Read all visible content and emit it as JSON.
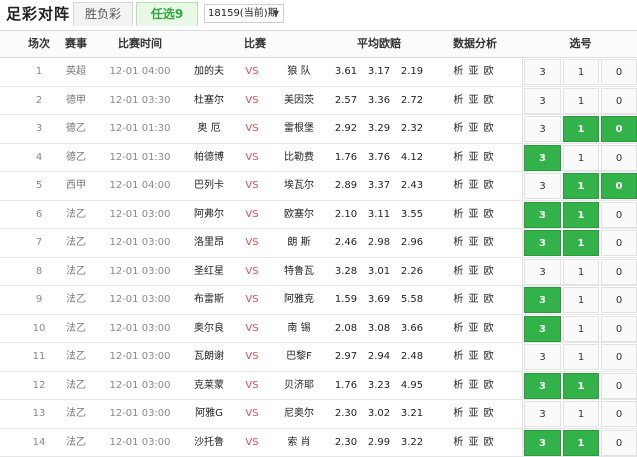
{
  "header": {
    "app_title": "足彩对阵",
    "tabs": [
      "胜负彩",
      "任选9"
    ],
    "period": "18159(当前)期",
    "period_caret": "▼"
  },
  "columns": {
    "no": "场次",
    "league": "赛事",
    "time": "比赛时间",
    "match": "比赛",
    "odds": "平均欧赔",
    "analysis": "数据分析",
    "pick": "选号"
  },
  "vs_label": "VS",
  "analysis_links": "析 亚 欧",
  "accent_color": "#34b24a",
  "rows": [
    {
      "no": "1",
      "league": "英超",
      "time": "12-01 04:00",
      "home": "加的夫",
      "away": "狼 队",
      "odds": [
        "3.61",
        "3.17",
        "2.19"
      ],
      "picks": [
        {
          "v": "3",
          "on": false
        },
        {
          "v": "1",
          "on": false
        },
        {
          "v": "0",
          "on": false
        }
      ]
    },
    {
      "no": "2",
      "league": "德甲",
      "time": "12-01 03:30",
      "home": "杜塞尔",
      "away": "美因茨",
      "odds": [
        "2.57",
        "3.36",
        "2.72"
      ],
      "picks": [
        {
          "v": "3",
          "on": false
        },
        {
          "v": "1",
          "on": false
        },
        {
          "v": "0",
          "on": false
        }
      ]
    },
    {
      "no": "3",
      "league": "德乙",
      "time": "12-01 01:30",
      "home": "奥 厄",
      "away": "雷根堡",
      "odds": [
        "2.92",
        "3.29",
        "2.32"
      ],
      "picks": [
        {
          "v": "3",
          "on": false
        },
        {
          "v": "1",
          "on": true
        },
        {
          "v": "0",
          "on": true
        }
      ]
    },
    {
      "no": "4",
      "league": "德乙",
      "time": "12-01 01:30",
      "home": "帕德博",
      "away": "比勒费",
      "odds": [
        "1.76",
        "3.76",
        "4.12"
      ],
      "picks": [
        {
          "v": "3",
          "on": true
        },
        {
          "v": "1",
          "on": false
        },
        {
          "v": "0",
          "on": false
        }
      ]
    },
    {
      "no": "5",
      "league": "西甲",
      "time": "12-01 04:00",
      "home": "巴列卡",
      "away": "埃瓦尔",
      "odds": [
        "2.89",
        "3.37",
        "2.43"
      ],
      "picks": [
        {
          "v": "3",
          "on": false
        },
        {
          "v": "1",
          "on": true
        },
        {
          "v": "0",
          "on": true
        }
      ]
    },
    {
      "no": "6",
      "league": "法乙",
      "time": "12-01 03:00",
      "home": "阿弗尔",
      "away": "欧塞尔",
      "odds": [
        "2.10",
        "3.11",
        "3.55"
      ],
      "picks": [
        {
          "v": "3",
          "on": true
        },
        {
          "v": "1",
          "on": true
        },
        {
          "v": "0",
          "on": false
        }
      ]
    },
    {
      "no": "7",
      "league": "法乙",
      "time": "12-01 03:00",
      "home": "洛里昂",
      "away": "朗 斯",
      "odds": [
        "2.46",
        "2.98",
        "2.96"
      ],
      "picks": [
        {
          "v": "3",
          "on": true
        },
        {
          "v": "1",
          "on": true
        },
        {
          "v": "0",
          "on": false
        }
      ]
    },
    {
      "no": "8",
      "league": "法乙",
      "time": "12-01 03:00",
      "home": "圣红星",
      "away": "特鲁瓦",
      "odds": [
        "3.28",
        "3.01",
        "2.26"
      ],
      "picks": [
        {
          "v": "3",
          "on": false
        },
        {
          "v": "1",
          "on": false
        },
        {
          "v": "0",
          "on": false
        }
      ]
    },
    {
      "no": "9",
      "league": "法乙",
      "time": "12-01 03:00",
      "home": "布雷斯",
      "away": "阿雅克",
      "odds": [
        "1.59",
        "3.69",
        "5.58"
      ],
      "picks": [
        {
          "v": "3",
          "on": true
        },
        {
          "v": "1",
          "on": false
        },
        {
          "v": "0",
          "on": false
        }
      ]
    },
    {
      "no": "10",
      "league": "法乙",
      "time": "12-01 03:00",
      "home": "奥尔良",
      "away": "南 锡",
      "odds": [
        "2.08",
        "3.08",
        "3.66"
      ],
      "picks": [
        {
          "v": "3",
          "on": true
        },
        {
          "v": "1",
          "on": false
        },
        {
          "v": "0",
          "on": false
        }
      ]
    },
    {
      "no": "11",
      "league": "法乙",
      "time": "12-01 03:00",
      "home": "瓦朗谢",
      "away": "巴黎F",
      "odds": [
        "2.97",
        "2.94",
        "2.48"
      ],
      "picks": [
        {
          "v": "3",
          "on": false
        },
        {
          "v": "1",
          "on": false
        },
        {
          "v": "0",
          "on": false
        }
      ]
    },
    {
      "no": "12",
      "league": "法乙",
      "time": "12-01 03:00",
      "home": "克莱蒙",
      "away": "贝济耶",
      "odds": [
        "1.76",
        "3.23",
        "4.95"
      ],
      "picks": [
        {
          "v": "3",
          "on": true
        },
        {
          "v": "1",
          "on": true
        },
        {
          "v": "0",
          "on": false
        }
      ]
    },
    {
      "no": "13",
      "league": "法乙",
      "time": "12-01 03:00",
      "home": "阿雅G",
      "away": "尼奥尔",
      "odds": [
        "2.30",
        "3.02",
        "3.21"
      ],
      "picks": [
        {
          "v": "3",
          "on": false
        },
        {
          "v": "1",
          "on": false
        },
        {
          "v": "0",
          "on": false
        }
      ]
    },
    {
      "no": "14",
      "league": "法乙",
      "time": "12-01 03:00",
      "home": "沙托鲁",
      "away": "索 肖",
      "odds": [
        "2.30",
        "2.99",
        "3.22"
      ],
      "picks": [
        {
          "v": "3",
          "on": true
        },
        {
          "v": "1",
          "on": true
        },
        {
          "v": "0",
          "on": false
        }
      ]
    }
  ]
}
